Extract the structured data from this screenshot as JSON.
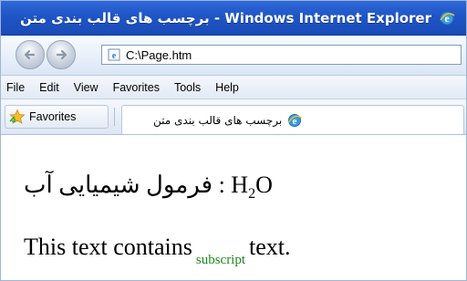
{
  "window": {
    "title": "برچسب های قالب بندی متن - Windows Internet Explorer"
  },
  "address_bar": {
    "url": "C:\\Page.htm"
  },
  "menu": {
    "items": [
      "File",
      "Edit",
      "View",
      "Favorites",
      "Tools",
      "Help"
    ]
  },
  "favorites_bar": {
    "favorites_label": "Favorites",
    "tab_label": "برچسب های قالب بندی متن"
  },
  "page": {
    "line1_text": "فرمول شیمیایی آب :",
    "formula_main": "H",
    "formula_sub": "2",
    "formula_end": "O",
    "line2_before": "This text contains",
    "line2_sub": "subscript",
    "line2_after": "text."
  },
  "colors": {
    "titlebar": "#1f55c6",
    "subscript_text": "#1b8a1b"
  }
}
